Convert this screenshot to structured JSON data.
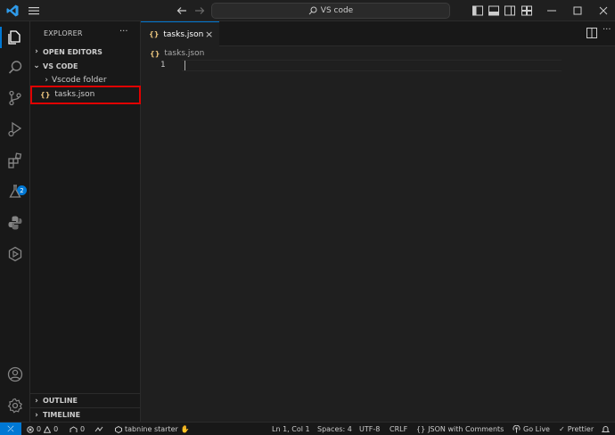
{
  "titlebar": {
    "search_text": "VS code"
  },
  "activitybar": {
    "extensions_badge": "2",
    "items": [
      "explorer-icon",
      "search-icon",
      "source-control-icon",
      "run-debug-icon",
      "extensions-icon",
      "testing-icon",
      "python-icon",
      "remote-icon",
      "account-icon",
      "settings-gear-icon"
    ]
  },
  "sidebar": {
    "title": "EXPLORER",
    "open_editors": "OPEN EDITORS",
    "workspace": "VS CODE",
    "folder": "Vscode folder",
    "file": "tasks.json",
    "outline": "OUTLINE",
    "timeline": "TIMELINE"
  },
  "editor": {
    "tab_label": "tasks.json",
    "breadcrumb_file": "tasks.json",
    "line_number": "1"
  },
  "statusbar": {
    "errors": "0",
    "warnings": "0",
    "ports": "0",
    "tabnine": "tabnine starter",
    "position": "Ln 1, Col 1",
    "spaces": "Spaces: 4",
    "encoding": "UTF-8",
    "eol": "CRLF",
    "language": "JSON with Comments",
    "go_live": "Go Live",
    "prettier": "Prettier"
  },
  "colors": {
    "accent": "#0078d4",
    "highlight_box": "#e00000",
    "json_glyph": "#e5c07b"
  }
}
